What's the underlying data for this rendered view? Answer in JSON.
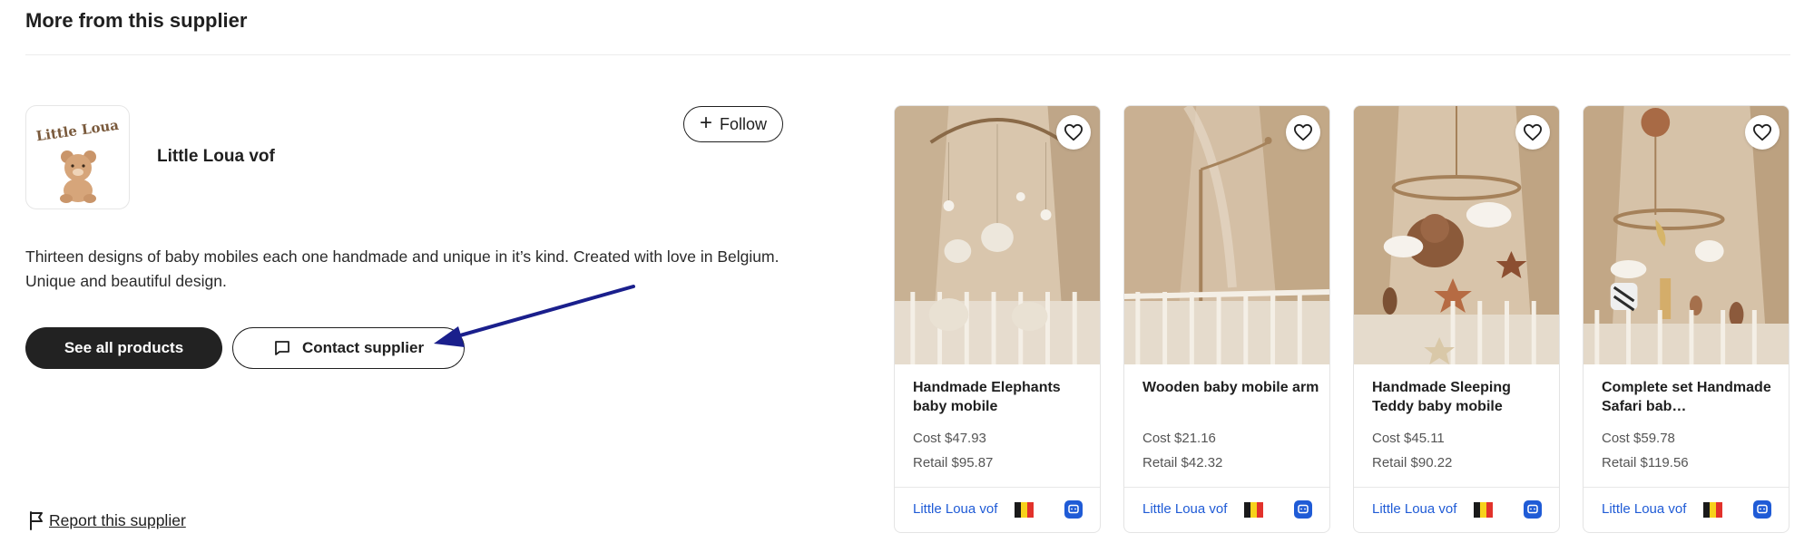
{
  "section": {
    "title": "More from this supplier"
  },
  "supplier": {
    "name": "Little Loua vof",
    "logo_text": "Little Loua",
    "description": "Thirteen designs of baby mobiles each one handmade and unique in it’s kind. Created with love in Belgium. Unique and beautiful design.",
    "follow_label": "Follow",
    "see_all_label": "See all products",
    "contact_label": "Contact supplier",
    "report_label": "Report this supplier"
  },
  "flag_colors": [
    "#1a1a1a",
    "#f7d21c",
    "#e2322b"
  ],
  "accent_color": "#1f5bd6",
  "products": [
    {
      "name": "Handmade Elephants baby mobile",
      "cost": "Cost $47.93",
      "retail": "Retail $95.87",
      "vendor": "Little Loua vof",
      "icon": "heart-icon"
    },
    {
      "name": "Wooden baby mobile arm",
      "cost": "Cost $21.16",
      "retail": "Retail $42.32",
      "vendor": "Little Loua vof",
      "icon": "heart-icon"
    },
    {
      "name": "Handmade Sleeping Teddy baby mobile",
      "cost": "Cost $45.11",
      "retail": "Retail $90.22",
      "vendor": "Little Loua vof",
      "icon": "heart-icon"
    },
    {
      "name": "Complete set Handmade Safari bab…",
      "cost": "Cost $59.78",
      "retail": "Retail $119.56",
      "vendor": "Little Loua vof",
      "icon": "heart-icon"
    }
  ]
}
